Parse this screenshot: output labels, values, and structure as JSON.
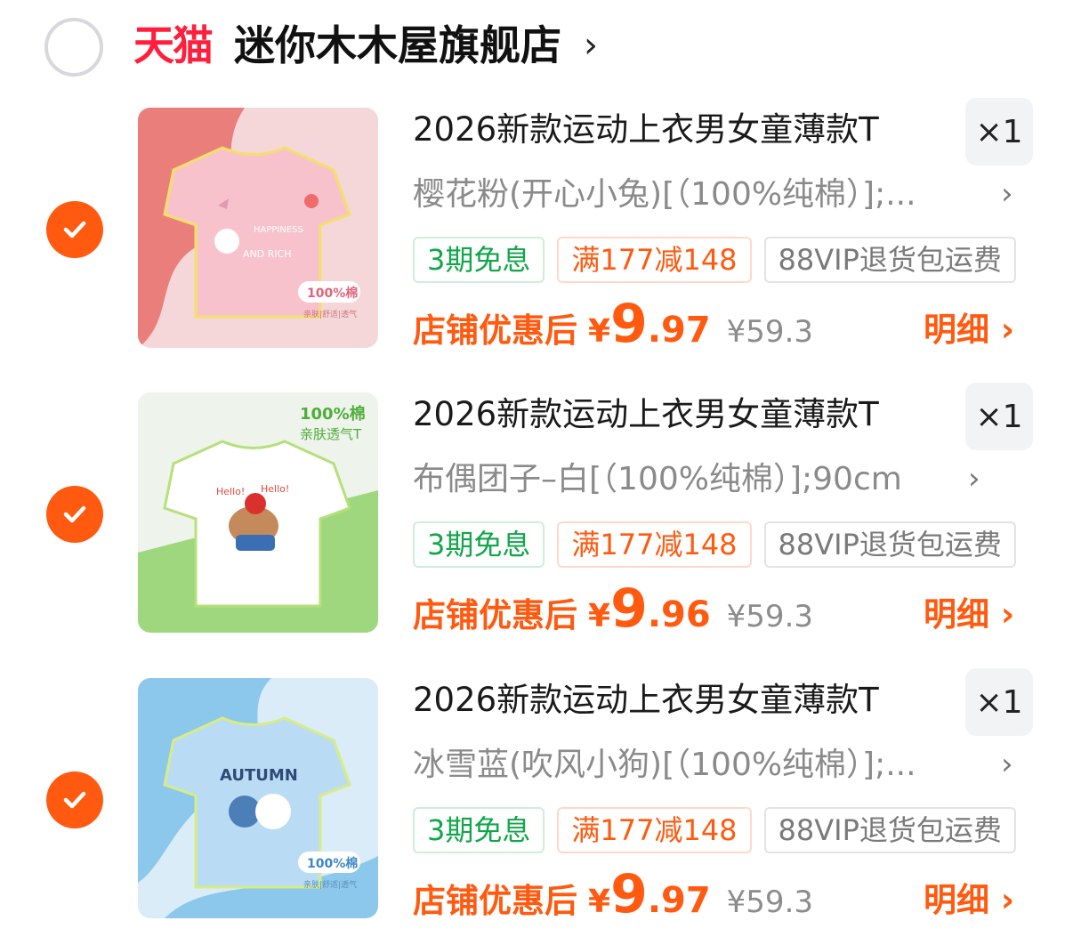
{
  "shop": {
    "logo_text": "天猫",
    "name": "迷你木木屋旗舰店",
    "chevron": "›"
  },
  "items": [
    {
      "title": "2026新款运动上衣男女童薄款T",
      "qty": "×1",
      "sku": "樱花粉(开心小兔)[（100%纯棉）];...",
      "sku_chevron": "›",
      "tags": [
        "3期免息",
        "满177减148",
        "88VIP退货包运费"
      ],
      "price_label": "店铺优惠后",
      "currency": "¥",
      "price_int": "9",
      "price_dec": ".97",
      "orig_price": "¥59.3",
      "detail": "明细 ›",
      "checked": true,
      "thumb_texts": [
        "100%棉",
        "亲肤|舒适|透气",
        "AND RICH",
        "HAPPINESS"
      ],
      "colors": {
        "bg": "#f6d7d9",
        "accent": "#ea7e7b",
        "shirt": "#f8c2cc"
      }
    },
    {
      "title": "2026新款运动上衣男女童薄款T",
      "qty": "×1",
      "sku": "布偶团子–白[（100%纯棉）];90cm",
      "sku_chevron": "›",
      "tags": [
        "3期免息",
        "满177减148",
        "88VIP退货包运费"
      ],
      "price_label": "店铺优惠后",
      "currency": "¥",
      "price_int": "9",
      "price_dec": ".96",
      "orig_price": "¥59.3",
      "detail": "明细 ›",
      "checked": true,
      "thumb_texts": [
        "100%棉",
        "亲肤透气T",
        "Hello!",
        "Hello!"
      ],
      "colors": {
        "bg": "#eef3ec",
        "accent": "#9fd77f",
        "shirt": "#ffffff"
      }
    },
    {
      "title": "2026新款运动上衣男女童薄款T",
      "qty": "×1",
      "sku": "冰雪蓝(吹风小狗)[（100%纯棉）];...",
      "sku_chevron": "›",
      "tags": [
        "3期免息",
        "满177减148",
        "88VIP退货包运费"
      ],
      "price_label": "店铺优惠后",
      "currency": "¥",
      "price_int": "9",
      "price_dec": ".97",
      "orig_price": "¥59.3",
      "detail": "明细 ›",
      "checked": true,
      "thumb_texts": [
        "100%棉",
        "亲肤|舒适|透气",
        "AUTUMN"
      ],
      "colors": {
        "bg": "#d9ecf8",
        "accent": "#8cc8ec",
        "shirt": "#b9dcf4"
      }
    }
  ],
  "icons": {
    "shop_radio": "radio-unchecked-icon",
    "item_check": "checkmark-circle-icon",
    "chevron": "chevron-right-icon"
  }
}
